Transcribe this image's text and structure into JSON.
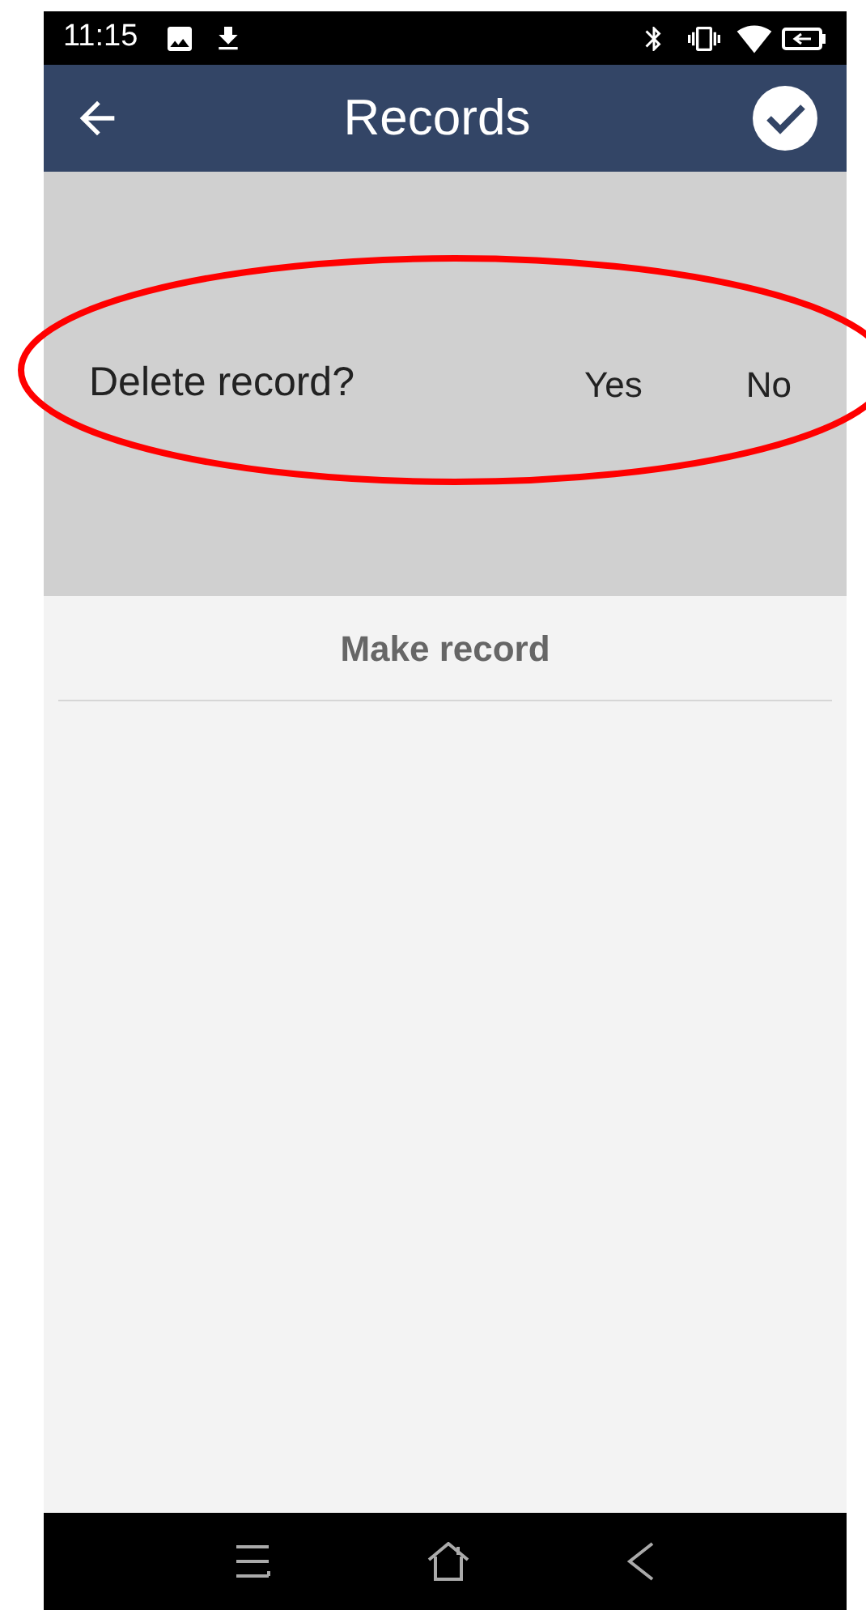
{
  "status_bar": {
    "time": "11:15"
  },
  "header": {
    "title": "Records"
  },
  "dialog": {
    "message": "Delete record?",
    "buttons": [
      "Yes",
      "No"
    ]
  },
  "list": {
    "items": [
      "Make record"
    ]
  },
  "annotation": {
    "kind": "ellipse",
    "color": "#ff0000"
  }
}
